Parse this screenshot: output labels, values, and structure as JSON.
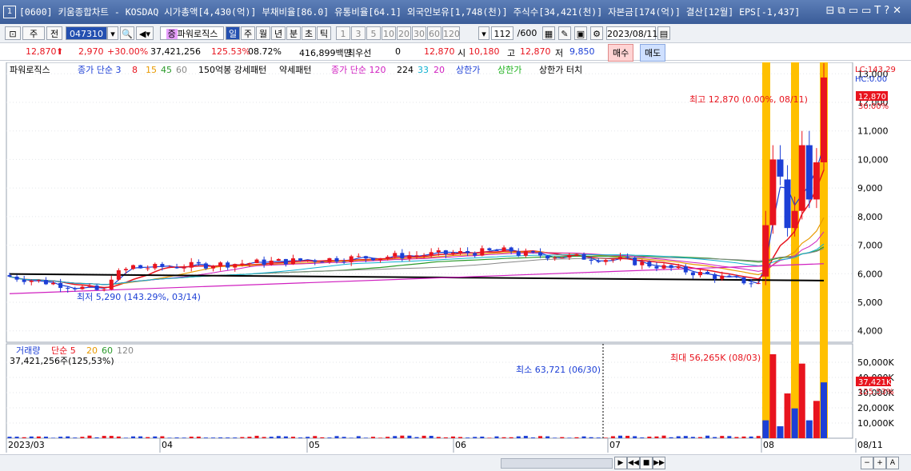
{
  "window": {
    "number": "1",
    "title": "[0600] 키움종합차트 - KOSDAQ 시가총액[4,430(억)] 부채비율[86.0] 유통비율[64.1] 외국인보유[1,748(천)] 주식수[34,421(천)] 자본금[174(억)] 결산[12월] EPS[-1,437]",
    "controls": "⊟⧉▭▭T?✕"
  },
  "toolbar": {
    "period_main": "주",
    "period_all": "전",
    "code": "047310",
    "stock_name": "파워로직스",
    "periods": [
      "일",
      "주",
      "월",
      "년",
      "분",
      "초",
      "틱"
    ],
    "active_period": "일",
    "intervals": [
      "1",
      "3",
      "5",
      "10",
      "20",
      "30",
      "60",
      "120"
    ],
    "count": "112",
    "count_total": "/600",
    "date": "2023/08/11"
  },
  "quote": {
    "price": "12,870",
    "change": "2,970",
    "change_pct": "+30.00%",
    "volume": "37,421,256",
    "vol_ratio": "125.53%",
    "turnover": "08.72%",
    "amount": "416,899백만",
    "pref_label": "최우선",
    "pref_val": "0",
    "price2": "12,870",
    "open_label": "시",
    "open": "10,180",
    "high_label": "고",
    "high": "12,870",
    "low_label": "저",
    "low": "9,850",
    "buy": "매수",
    "sell": "매도"
  },
  "legend_price": {
    "name": "파워로직스",
    "ma_label": "종가 단순 3",
    "ma_values": [
      "8",
      "15",
      "45",
      "60"
    ],
    "pattern1": "150억봉 강세패턴",
    "pattern2": "약세패턴",
    "ma2_label": "종가 단순 120",
    "ma2_values": [
      "224",
      "33",
      "20"
    ],
    "limit_up": "상한가",
    "limit_up2": "상한가",
    "limit_touch": "상한가 터치"
  },
  "legend_volume": {
    "name": "거래량",
    "ma_label": "단순 5",
    "ma_values": [
      "20",
      "60",
      "120"
    ],
    "current": "37,421,256주(125,53%)"
  },
  "annotations": {
    "price_high": "최고 12,870 (0.00%, 08/11)",
    "price_low": "최저 5,290 (143.29%, 03/14)",
    "vol_high": "최대 56,265K (08/03)",
    "vol_low": "최소 63,721 (06/30)",
    "lc": "LC:143.29",
    "hc": "HC:0.00",
    "last_price_tag": "12,870",
    "last_price_pct": "30.00%",
    "last_vol_tag": "37,421K",
    "last_vol_pct": "125.53%"
  },
  "chart_data": {
    "type": "candlestick",
    "price_axis": [
      "13,000",
      "12,000",
      "11,000",
      "10,000",
      "9,000",
      "8,000",
      "7,000",
      "6,000",
      "5,000",
      "4,000"
    ],
    "volume_axis": [
      "50,000K",
      "40,000K",
      "30,000K",
      "20,000K",
      "10,000K"
    ],
    "x_labels": [
      "2023/03",
      "04",
      "05",
      "06",
      "07",
      "08",
      "08/11"
    ],
    "ylim": [
      3600,
      13400
    ],
    "candles_recent": [
      {
        "o": 5900,
        "c": 7700
      },
      {
        "o": 7700,
        "c": 10000
      },
      {
        "o": 10000,
        "c": 9400
      },
      {
        "o": 9300,
        "c": 7600
      },
      {
        "o": 7600,
        "c": 8200
      },
      {
        "o": 8200,
        "c": 10500
      },
      {
        "o": 10500,
        "c": 8600
      },
      {
        "o": 8600,
        "c": 9900
      },
      {
        "o": 9900,
        "c": 12870
      }
    ],
    "colors": {
      "up": "#e8141e",
      "down": "#1c3fd6",
      "highlight": "#ffc000"
    }
  }
}
